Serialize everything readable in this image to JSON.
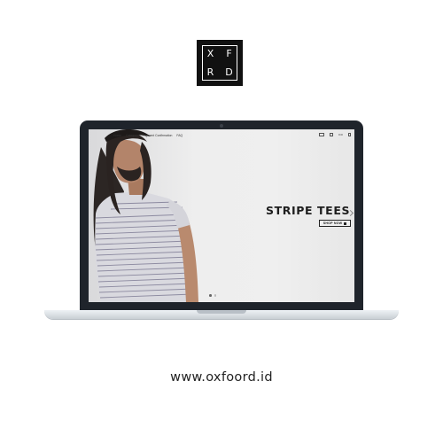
{
  "logo": {
    "letters": [
      "X",
      "F",
      "R",
      "D"
    ]
  },
  "site": {
    "nav": [
      "Home",
      "Category",
      "Payment Confirmation",
      "FAQ"
    ],
    "nav_right_text": "IDR"
  },
  "hero": {
    "title": "STRIPE TEES",
    "button_label": "SHOP NOW",
    "slide_count": 2,
    "active_slide": 1
  },
  "url": "www.oxfoord.id",
  "colors": {
    "laptop_bezel": "#1f242b",
    "text": "#222222",
    "background": "#ffffff"
  }
}
